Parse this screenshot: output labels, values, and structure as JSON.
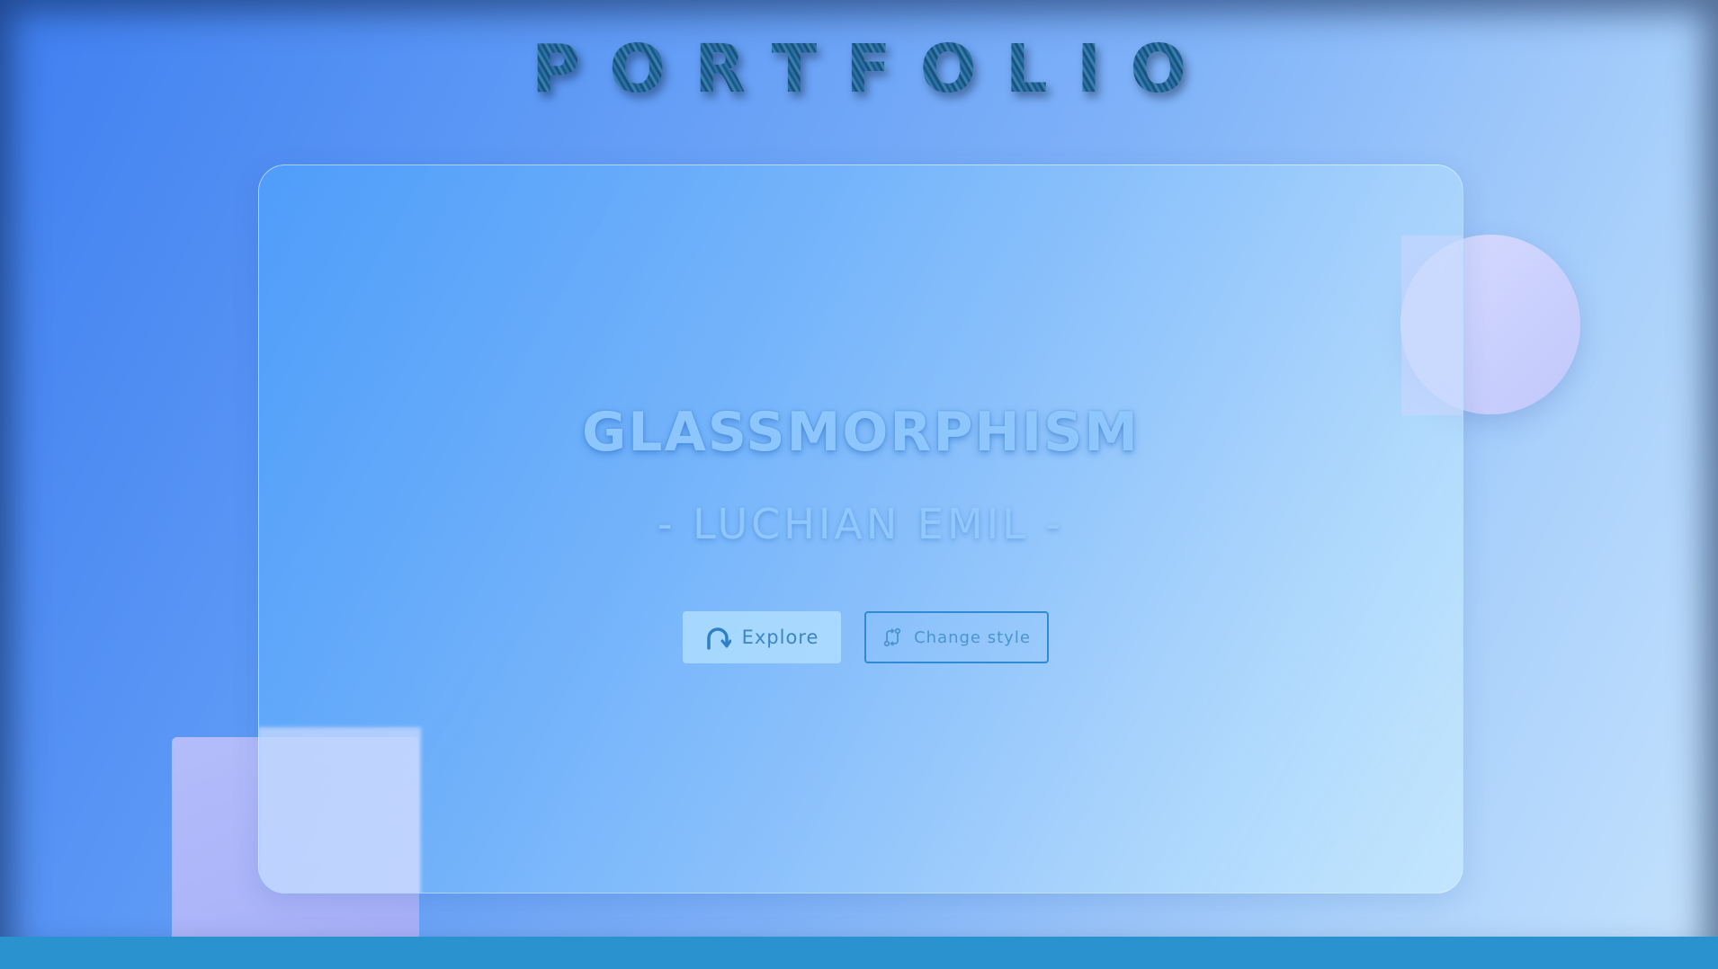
{
  "page": {
    "title": "PORTFOLIO"
  },
  "hero": {
    "title": "GLASSMORPHISM",
    "subtitle": "- LUCHIAN EMIL -"
  },
  "buttons": {
    "explore": {
      "label": "Explore",
      "icon": "arc-arrow-icon"
    },
    "change_style": {
      "label": "Change style",
      "icon": "git-compare-icon"
    }
  },
  "colors": {
    "background_start": "#3f7ff0",
    "background_end": "#c4e2fd",
    "accent": "#2e8bd3",
    "title": "#1e5c8e",
    "bottom_bar": "#2a93cf",
    "square_shape": "#aab4f8",
    "circle_shape": "#cdd3fd"
  }
}
